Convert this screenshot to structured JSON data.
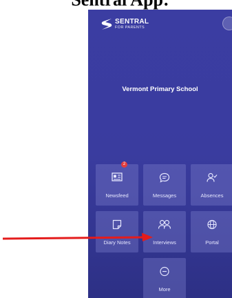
{
  "document": {
    "heading": "Sentral App:"
  },
  "app": {
    "logo_title": "SENTRAL",
    "logo_subtitle": "FOR PARENTS",
    "school_name": "Vermont Primary School"
  },
  "tiles": [
    {
      "label": "Newsfeed",
      "icon": "newsfeed-icon",
      "badge": "2"
    },
    {
      "label": "Messages",
      "icon": "chat-icon"
    },
    {
      "label": "Absences",
      "icon": "person-check-icon"
    },
    {
      "label": "Diary Notes",
      "icon": "note-icon"
    },
    {
      "label": "Interviews",
      "icon": "people-icon"
    },
    {
      "label": "Portal",
      "icon": "globe-icon"
    },
    {
      "label": "More",
      "icon": "more-icon"
    }
  ],
  "colors": {
    "background": "#3b3da2",
    "tile": "#5e60b8",
    "arrow": "#e41c1c",
    "badge": "#e23d3d"
  }
}
